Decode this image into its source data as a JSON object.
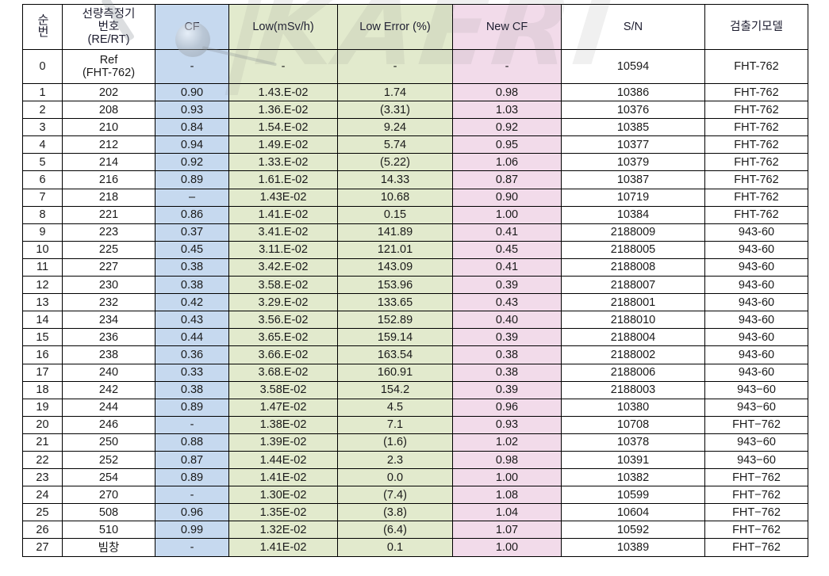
{
  "watermark": {
    "text": "KAERI",
    "logo": "kaeri-atom-logo"
  },
  "table": {
    "columns": [
      {
        "key": "no",
        "label": "순번",
        "vertical": true
      },
      {
        "key": "id",
        "label": "선량측정기\n번호\n(RE/RT)"
      },
      {
        "key": "cf",
        "label": "CF"
      },
      {
        "key": "low",
        "label": "Low(mSv/h)"
      },
      {
        "key": "err",
        "label": "Low Error (%)"
      },
      {
        "key": "ncf",
        "label": "New CF"
      },
      {
        "key": "sn",
        "label": "S/N"
      },
      {
        "key": "model",
        "label": "검출기모델"
      }
    ],
    "header_line1": "선량측정기",
    "header_line2": "번호",
    "header_line3": "(RE/RT)",
    "ref_row": {
      "no": "0",
      "id_line1": "Ref",
      "id_line2": "(FHT-762)",
      "cf": "-",
      "low": "-",
      "err": "-",
      "ncf": "-",
      "sn": "10594",
      "model": "FHT-762"
    },
    "rows": [
      {
        "no": "1",
        "id": "202",
        "cf": "0.90",
        "low": "1.43.E-02",
        "err": "1.74",
        "ncf": "0.98",
        "sn": "10386",
        "model": "FHT-762"
      },
      {
        "no": "2",
        "id": "208",
        "cf": "0.93",
        "low": "1.36.E-02",
        "err": "(3.31)",
        "ncf": "1.03",
        "sn": "10376",
        "model": "FHT-762"
      },
      {
        "no": "3",
        "id": "210",
        "cf": "0.84",
        "low": "1.54.E-02",
        "err": "9.24",
        "ncf": "0.92",
        "sn": "10385",
        "model": "FHT-762"
      },
      {
        "no": "4",
        "id": "212",
        "cf": "0.94",
        "low": "1.49.E-02",
        "err": "5.74",
        "ncf": "0.95",
        "sn": "10377",
        "model": "FHT-762"
      },
      {
        "no": "5",
        "id": "214",
        "cf": "0.92",
        "low": "1.33.E-02",
        "err": "(5.22)",
        "ncf": "1.06",
        "sn": "10379",
        "model": "FHT-762"
      },
      {
        "no": "6",
        "id": "216",
        "cf": "0.89",
        "low": "1.61.E-02",
        "err": "14.33",
        "ncf": "0.87",
        "sn": "10387",
        "model": "FHT-762"
      },
      {
        "no": "7",
        "id": "218",
        "cf": "–",
        "low": "1.43E-02",
        "err": "10.68",
        "ncf": "0.90",
        "sn": "10719",
        "model": "FHT-762"
      },
      {
        "no": "8",
        "id": "221",
        "cf": "0.86",
        "low": "1.41.E-02",
        "err": "0.15",
        "ncf": "1.00",
        "sn": "10384",
        "model": "FHT-762"
      },
      {
        "no": "9",
        "id": "223",
        "cf": "0.37",
        "low": "3.41.E-02",
        "err": "141.89",
        "ncf": "0.41",
        "sn": "2188009",
        "model": "943-60"
      },
      {
        "no": "10",
        "id": "225",
        "cf": "0.45",
        "low": "3.11.E-02",
        "err": "121.01",
        "ncf": "0.45",
        "sn": "2188005",
        "model": "943-60"
      },
      {
        "no": "11",
        "id": "227",
        "cf": "0.38",
        "low": "3.42.E-02",
        "err": "143.09",
        "ncf": "0.41",
        "sn": "2188008",
        "model": "943-60"
      },
      {
        "no": "12",
        "id": "230",
        "cf": "0.38",
        "low": "3.58.E-02",
        "err": "153.96",
        "ncf": "0.39",
        "sn": "2188007",
        "model": "943-60"
      },
      {
        "no": "13",
        "id": "232",
        "cf": "0.42",
        "low": "3.29.E-02",
        "err": "133.65",
        "ncf": "0.43",
        "sn": "2188001",
        "model": "943-60"
      },
      {
        "no": "14",
        "id": "234",
        "cf": "0.43",
        "low": "3.56.E-02",
        "err": "152.89",
        "ncf": "0.40",
        "sn": "2188010",
        "model": "943-60"
      },
      {
        "no": "15",
        "id": "236",
        "cf": "0.44",
        "low": "3.65.E-02",
        "err": "159.14",
        "ncf": "0.39",
        "sn": "2188004",
        "model": "943-60"
      },
      {
        "no": "16",
        "id": "238",
        "cf": "0.36",
        "low": "3.66.E-02",
        "err": "163.54",
        "ncf": "0.38",
        "sn": "2188002",
        "model": "943-60"
      },
      {
        "no": "17",
        "id": "240",
        "cf": "0.33",
        "low": "3.68.E-02",
        "err": "160.91",
        "ncf": "0.38",
        "sn": "2188006",
        "model": "943-60"
      },
      {
        "no": "18",
        "id": "242",
        "cf": "0.38",
        "low": "3.58E-02",
        "err": "154.2",
        "ncf": "0.39",
        "sn": "2188003",
        "model": "943−60"
      },
      {
        "no": "19",
        "id": "244",
        "cf": "0.89",
        "low": "1.47E-02",
        "err": "4.5",
        "ncf": "0.96",
        "sn": "10380",
        "model": "943−60"
      },
      {
        "no": "20",
        "id": "246",
        "cf": "-",
        "low": "1.38E-02",
        "err": "7.1",
        "ncf": "0.93",
        "sn": "10708",
        "model": "FHT−762"
      },
      {
        "no": "21",
        "id": "250",
        "cf": "0.88",
        "low": "1.39E-02",
        "err": "(1.6)",
        "ncf": "1.02",
        "sn": "10378",
        "model": "943−60"
      },
      {
        "no": "22",
        "id": "252",
        "cf": "0.87",
        "low": "1.44E-02",
        "err": "2.3",
        "ncf": "0.98",
        "sn": "10391",
        "model": "943−60"
      },
      {
        "no": "23",
        "id": "254",
        "cf": "0.89",
        "low": "1.41E-02",
        "err": "0.0",
        "ncf": "1.00",
        "sn": "10382",
        "model": "FHT−762"
      },
      {
        "no": "24",
        "id": "270",
        "cf": "-",
        "low": "1.30E-02",
        "err": "(7.4)",
        "ncf": "1.08",
        "sn": "10599",
        "model": "FHT−762"
      },
      {
        "no": "25",
        "id": "508",
        "cf": "0.96",
        "low": "1.35E-02",
        "err": "(3.8)",
        "ncf": "1.04",
        "sn": "10604",
        "model": "FHT−762"
      },
      {
        "no": "26",
        "id": "510",
        "cf": "0.99",
        "low": "1.32E-02",
        "err": "(6.4)",
        "ncf": "1.07",
        "sn": "10592",
        "model": "FHT−762"
      },
      {
        "no": "27",
        "id": "빔창",
        "cf": "-",
        "low": "1.41E-02",
        "err": "0.1",
        "ncf": "1.00",
        "sn": "10389",
        "model": "FHT−762"
      }
    ]
  },
  "colors": {
    "cf_column": "#c6d9ef",
    "low_column": "#e2eacd",
    "error_column": "#e2eacd",
    "newcf_column": "#f2dbea",
    "border": "#000000",
    "text": "#1a1a1a"
  }
}
